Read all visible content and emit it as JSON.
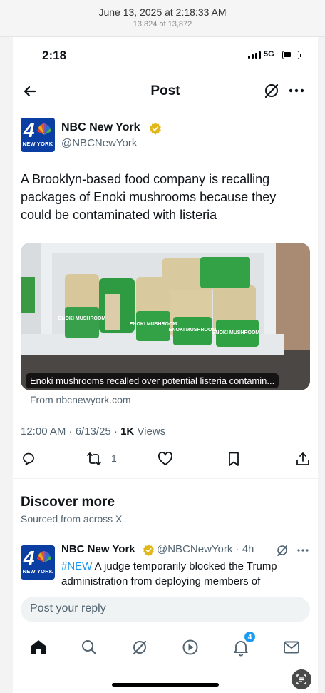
{
  "photos": {
    "date": "June 13, 2025 at 2:18:33 AM",
    "count": "13,824 of 13,872"
  },
  "status_bar": {
    "time": "2:18",
    "network": "5G"
  },
  "nav": {
    "title": "Post",
    "back_icon": "back-arrow-icon",
    "grok_icon": "grok-icon",
    "more_icon": "more-icon"
  },
  "post": {
    "author_name": "NBC New York",
    "author_handle": "@NBCNewYork",
    "avatar_text": "4",
    "avatar_sub": "NEW YORK",
    "text": "A Brooklyn-based food company is recalling packages of Enoki mushrooms because they could be contaminated with listeria",
    "media_caption": "Enoki mushrooms recalled over potential listeria contamin...",
    "media_label": "ENOKI MUSHROOM",
    "source": "From nbcnewyork.com",
    "timestamp": "12:00 AM · 6/13/25 · ",
    "views_count": "1K",
    "views_label": " Views",
    "retweet_count": "1"
  },
  "discover": {
    "title": "Discover more",
    "subtitle": "Sourced from across X",
    "items": [
      {
        "author_name": "NBC New York",
        "author_handle": "@NBCNewYork · 4h",
        "hashtag": "#NEW",
        "text": " A judge temporarily blocked the Trump administration from deploying members of"
      }
    ]
  },
  "reply": {
    "placeholder": "Post your reply"
  },
  "tabbar": {
    "notifications_badge": "4"
  },
  "colors": {
    "accent": "#1d9bf0",
    "verified_gold": "#e2b719",
    "nbc_blue": "#0a3ea3",
    "text_secondary": "#536471"
  }
}
